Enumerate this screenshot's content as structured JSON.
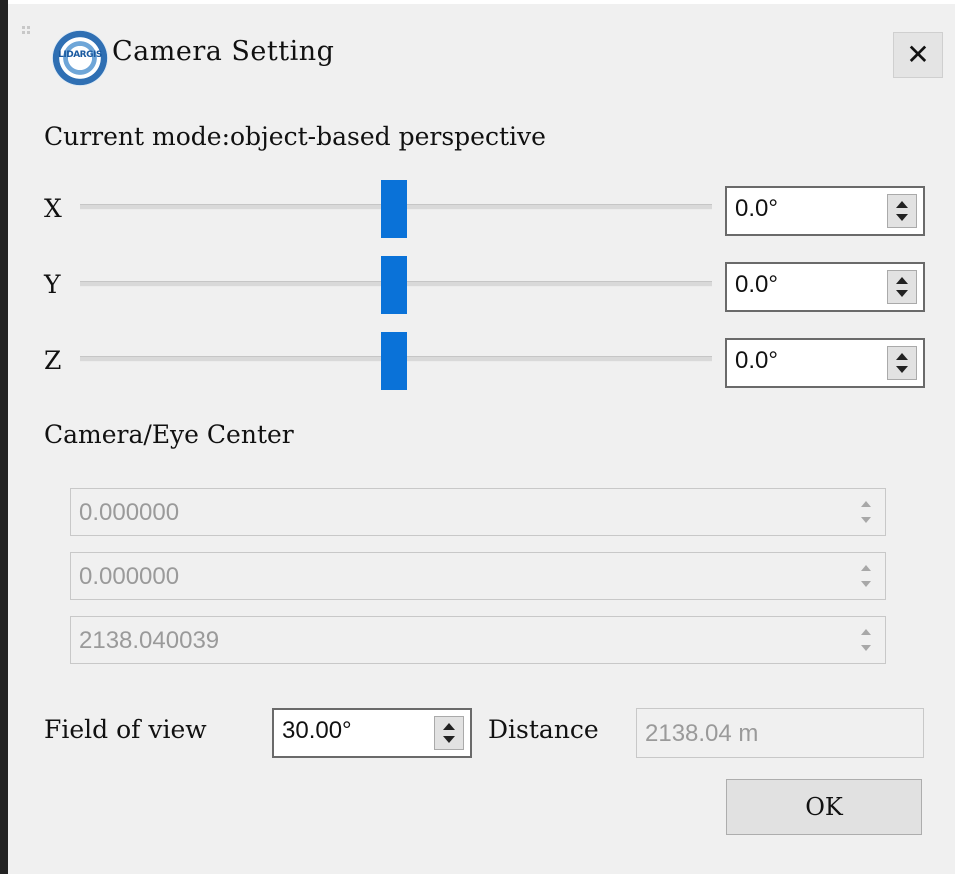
{
  "window": {
    "title": "Camera Setting",
    "logo_text": "LIDARGIS",
    "close_label": "✕"
  },
  "mode": {
    "label": "Current mode:object-based perspective"
  },
  "rotation": [
    {
      "axis": "X",
      "value": "0.0°",
      "slider_position_fraction": 0.5
    },
    {
      "axis": "Y",
      "value": "0.0°",
      "slider_position_fraction": 0.5
    },
    {
      "axis": "Z",
      "value": "0.0°",
      "slider_position_fraction": 0.5
    }
  ],
  "eye_center": {
    "label": "Camera/Eye Center",
    "values": [
      "0.000000",
      "0.000000",
      "2138.040039"
    ]
  },
  "field_of_view": {
    "label": "Field of view",
    "value": "30.00°"
  },
  "distance": {
    "label": "Distance",
    "value": "2138.04 m"
  },
  "ok_label": "OK",
  "colors": {
    "background": "#f0f0f0",
    "slider_handle": "#0a72d8"
  }
}
